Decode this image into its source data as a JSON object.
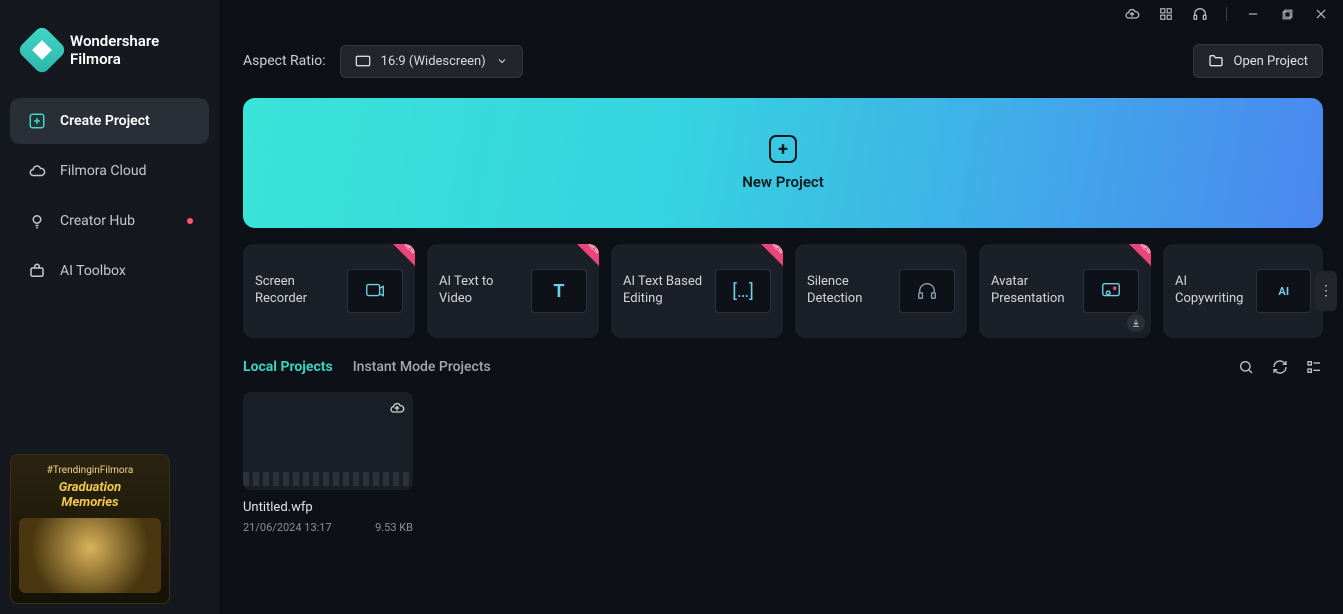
{
  "brand": {
    "line1": "Wondershare",
    "line2": "Filmora"
  },
  "nav": {
    "create": "Create Project",
    "cloud": "Filmora Cloud",
    "hub": "Creator Hub",
    "toolbox": "AI Toolbox"
  },
  "promo": {
    "tag": "#TrendinginFilmora",
    "title1": "Graduation",
    "title2": "Memories"
  },
  "aspect": {
    "label": "Aspect Ratio:",
    "value": "16:9 (Widescreen)"
  },
  "open_project": "Open Project",
  "new_project": "New Project",
  "tools": [
    {
      "label": "Screen Recorder",
      "new": true
    },
    {
      "label": "AI Text to Video",
      "new": true
    },
    {
      "label": "AI Text Based Editing",
      "new": true
    },
    {
      "label": "Silence Detection",
      "new": false
    },
    {
      "label": "Avatar Presentation",
      "new": true,
      "download": true
    },
    {
      "label": "AI Copywriting",
      "new": false
    }
  ],
  "tabs": {
    "local": "Local Projects",
    "instant": "Instant Mode Projects"
  },
  "projects": [
    {
      "name": "Untitled.wfp",
      "date": "21/06/2024 13:17",
      "size": "9.53 KB"
    }
  ]
}
